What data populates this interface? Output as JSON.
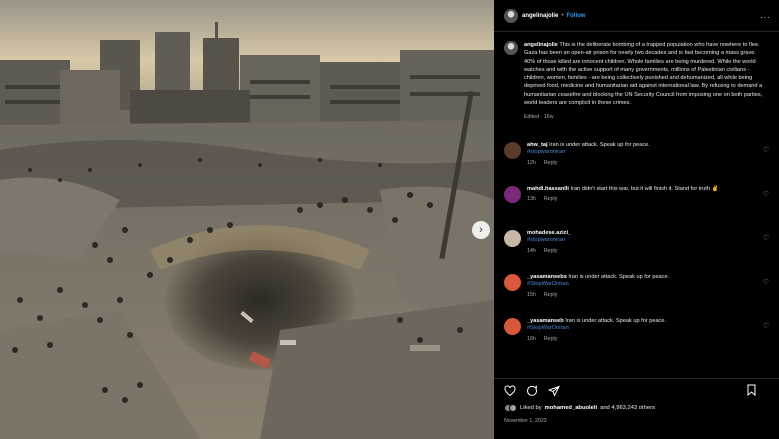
{
  "post": {
    "username": "angelinajolie",
    "follow_label": "Follow",
    "caption": "This is the deliberate bombing of a trapped population who have nowhere to flee. Gaza has been an open-air prison for nearly two decades and is fast becoming a mass grave. 40% of those killed are innocent children. Whole families are being murdered. While the world watches and with the active support of many governments, millions of Palestinian civilians - children, women, families - are being collectively punished and dehumanized, all while being deprived food, medicine and humanitarian aid against international law. By refusing to demand a humanitarian ceasefire and blocking the UN Security Council from imposing one on both parties, world leaders are complicit in these crimes.",
    "caption_meta": "Edited · 16w",
    "likes_prefix": "Liked by",
    "likes_user": "mohamed_abuoleli",
    "likes_suffix": "and 4,963,243 others",
    "date": "November 1, 2023"
  },
  "comments": [
    {
      "user": "ahw_taj",
      "text": "Iran is under attack. Speak up for peace.",
      "tag": "#stopwaroniran",
      "age": "12h",
      "reply_label": "Reply",
      "avatar_color": "#5a3a2a"
    },
    {
      "user": "mahdi.hassanlli",
      "text": "Iran didn't start this war, but it will finish it. Stand for truth ✌",
      "tag": "",
      "age": "13h",
      "reply_label": "Reply",
      "avatar_color": "#7b2a7a"
    },
    {
      "user": "mohadese.azizi_",
      "text": "",
      "tag": "#stopwaroniran",
      "age": "14h",
      "reply_label": "Reply",
      "avatar_color": "#c8b8a8"
    },
    {
      "user": "_yasamansebs",
      "text": "Iran is under attack. Speak up for peace.",
      "tag": "#StopWarOnIran",
      "age": "15h",
      "reply_label": "Reply",
      "avatar_color": "#d9573a"
    },
    {
      "user": "_yasamanseb",
      "text": "Iran is under attack. Speak up for peace.",
      "tag": "#StopWarOnIran",
      "age": "16h",
      "reply_label": "Reply",
      "avatar_color": "#d9573a"
    }
  ],
  "icons": {
    "more": "more-options-icon",
    "like": "heart-icon",
    "comment": "comment-icon",
    "share": "share-icon",
    "save": "bookmark-icon",
    "next": "chevron-right-icon"
  },
  "colors": {
    "panel_bg": "#000000",
    "link": "#3797f0",
    "hashtag": "#4f86d9",
    "muted": "#a8a8a8"
  }
}
